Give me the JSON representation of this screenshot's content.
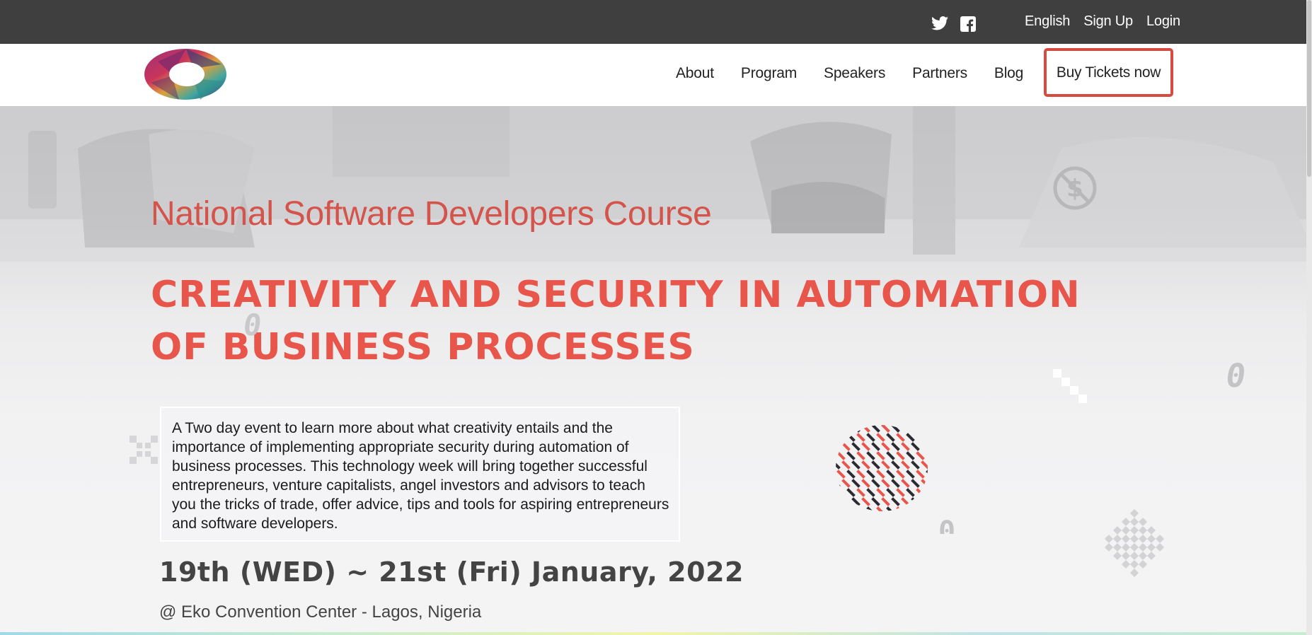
{
  "topbar": {
    "social": [
      {
        "icon": "twitter-icon"
      },
      {
        "icon": "facebook-icon"
      }
    ],
    "links": [
      "English",
      "Sign Up",
      "Login"
    ]
  },
  "nav": {
    "logo": "event-logo",
    "items": [
      "About",
      "Program",
      "Speakers",
      "Partners",
      "Blog"
    ],
    "cta_label": "Buy Tickets now",
    "cta_border_color": "#d74a40"
  },
  "hero": {
    "subtitle": "National Software Developers Course",
    "headline": "CREATIVITY AND SECURITY IN AUTOMATION OF BUSINESS PROCESSES",
    "description": "A Two day event to learn more about what creativity entails and the importance of implementing appropriate security during automation of business processes. This technology week will bring together successful entrepreneurs, venture capitalists, angel investors and advisors to teach you the tricks of trade, offer advice, tips and tools for aspiring entrepreneurs and software developers.",
    "date": "19th (WED) ~ 21st (Fri) January, 2022",
    "venue": "@ Eko Convention Center - Lagos, Nigeria",
    "accent_color": "#e8554b"
  }
}
